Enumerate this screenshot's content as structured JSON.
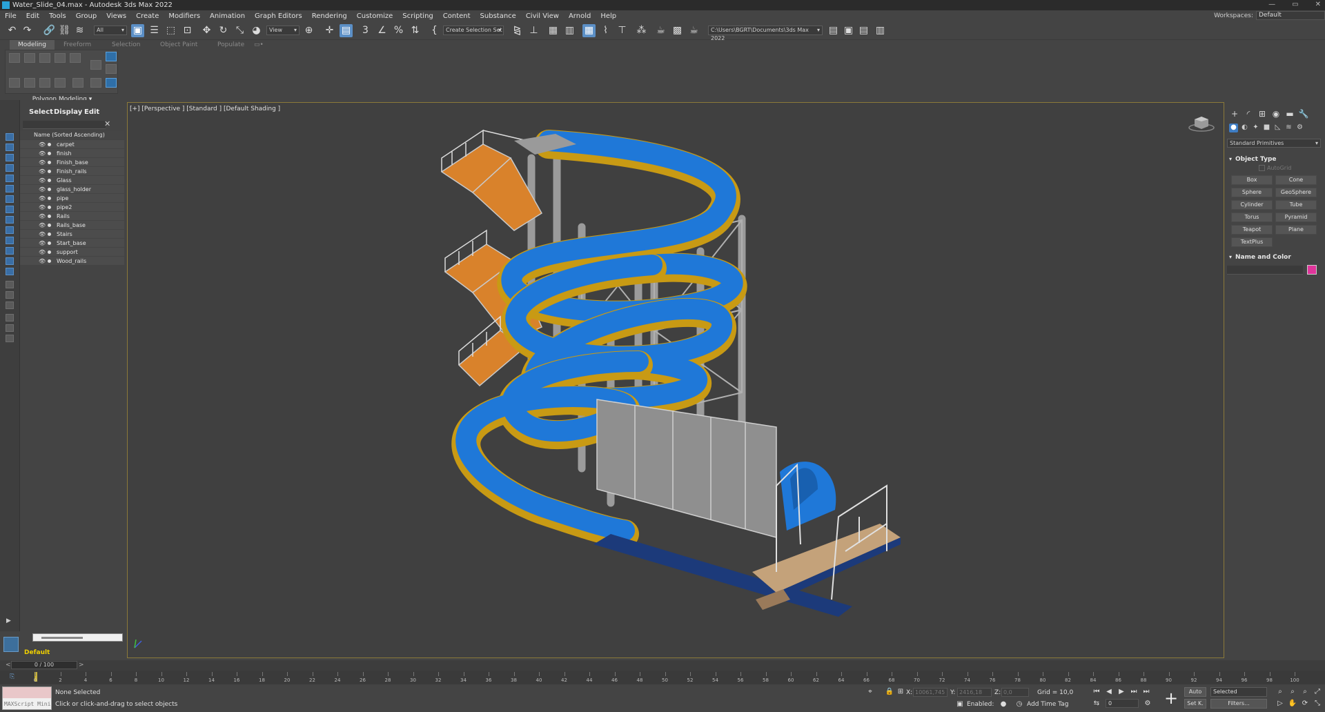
{
  "window": {
    "title": "Water_Slide_04.max - Autodesk 3ds Max 2022",
    "controls": [
      "—",
      "▭",
      "✕"
    ]
  },
  "menu": [
    "File",
    "Edit",
    "Tools",
    "Group",
    "Views",
    "Create",
    "Modifiers",
    "Animation",
    "Graph Editors",
    "Rendering",
    "Customize",
    "Scripting",
    "Content",
    "Substance",
    "Civil View",
    "Arnold",
    "Help"
  ],
  "workspace": {
    "label": "Workspaces:",
    "value": "Default"
  },
  "toolbar": {
    "filter": "All",
    "ref_coord": "View",
    "selection_set": "Create Selection Set",
    "project_path": "C:\\Users\\BGRT\\Documents\\3ds Max 2022"
  },
  "ribbon": {
    "tabs": [
      "Modeling",
      "Freeform",
      "Selection",
      "Object Paint",
      "Populate"
    ],
    "panel_caption": "Polygon Modeling"
  },
  "explorer": {
    "tabs": [
      "Select",
      "Display",
      "Edit"
    ],
    "header": "Name (Sorted Ascending)",
    "items": [
      "carpet",
      "finish",
      "Finish_base",
      "Finish_rails",
      "Glass",
      "glass_holder",
      "pipe",
      "pipe2",
      "Rails",
      "Rails_base",
      "Stairs",
      "Start_base",
      "support",
      "Wood_rails"
    ],
    "layer": "Default"
  },
  "viewport": {
    "label": "[+] [Perspective ] [Standard ] [Default Shading ]"
  },
  "command_panel": {
    "dropdown": "Standard Primitives",
    "object_type_title": "Object Type",
    "autogrid": "AutoGrid",
    "primitives": [
      "Box",
      "Cone",
      "Sphere",
      "GeoSphere",
      "Cylinder",
      "Tube",
      "Torus",
      "Pyramid",
      "Teapot",
      "Plane",
      "TextPlus"
    ],
    "name_color_title": "Name and Color"
  },
  "timeline": {
    "frame_display": "0 / 100",
    "ticks": [
      0,
      2,
      4,
      6,
      8,
      10,
      12,
      14,
      16,
      18,
      20,
      22,
      24,
      26,
      28,
      30,
      32,
      34,
      36,
      38,
      40,
      42,
      44,
      46,
      48,
      50,
      52,
      54,
      56,
      58,
      60,
      62,
      64,
      66,
      68,
      70,
      72,
      74,
      76,
      78,
      80,
      82,
      84,
      86,
      88,
      90,
      92,
      94,
      96,
      98,
      100
    ]
  },
  "status": {
    "maxscript_label": "MAXScript Mini",
    "selection": "None Selected",
    "prompt": "Click or click-and-drag to select objects",
    "x_label": "X:",
    "x_value": "10061,745",
    "y_label": "Y:",
    "y_value": "2416,18",
    "z_label": "Z:",
    "z_value": "0,0",
    "grid": "Grid = 10,0",
    "enabled": "Enabled:",
    "add_time_tag": "Add Time Tag",
    "auto": "Auto",
    "set_key": "Set K.",
    "selected": "Selected",
    "filters": "Filters...",
    "frame": "0"
  },
  "colors": {
    "accent": "#5b8fc6",
    "slide_blue": "#1f78d8",
    "slide_yellow": "#e0b020",
    "viewport_border": "#8c7a3a",
    "layer_yellow": "#f0d000"
  }
}
